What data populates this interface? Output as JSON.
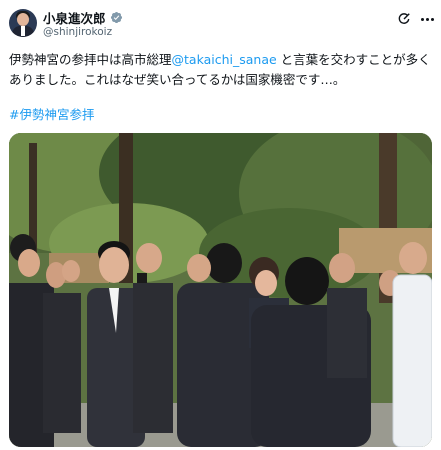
{
  "post": {
    "author": {
      "display_name": "小泉進次郎",
      "handle": "@shinjirokoiz",
      "verified": true
    },
    "text_before_mention": "伊勢神宮の参拝中は高市総理",
    "mention": "@takaichi_sanae",
    "text_after_mention_line1": " と言葉を交わすことが多く",
    "text_line2": "ありました。これはなぜ笑い合ってるかは国家機密です…。",
    "hashtag": "#伊勢神宮参拝"
  },
  "icons": {
    "verified": "verified-badge-icon",
    "grok": "grok-icon",
    "more": "more-icon"
  },
  "colors": {
    "accent": "#1d9bf0",
    "text": "#0f1419",
    "secondary": "#536471"
  }
}
